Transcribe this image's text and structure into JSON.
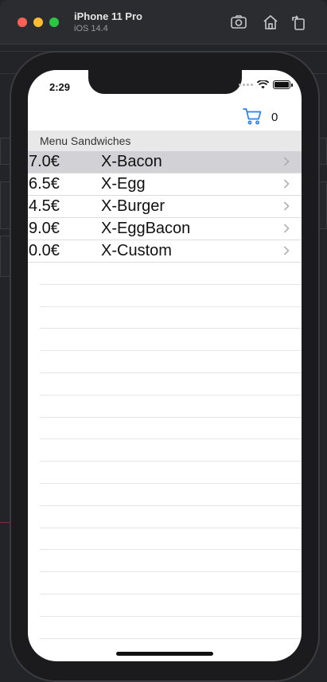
{
  "simulator": {
    "device_name": "iPhone 11 Pro",
    "os_version": "iOS 14.4",
    "icons": [
      "screenshot-icon",
      "home-icon",
      "rotate-icon"
    ]
  },
  "status_bar": {
    "time": "2:29"
  },
  "nav": {
    "cart_icon": "cart-icon",
    "cart_count": "0",
    "accent_color": "#2f80ed"
  },
  "menu": {
    "section_title": "Menu Sandwiches",
    "items": [
      {
        "price": "7.0€",
        "name": "X-Bacon",
        "selected": true
      },
      {
        "price": "6.5€",
        "name": "X-Egg",
        "selected": false
      },
      {
        "price": "4.5€",
        "name": "X-Burger",
        "selected": false
      },
      {
        "price": "9.0€",
        "name": "X-EggBacon",
        "selected": false
      },
      {
        "price": "0.0€",
        "name": "X-Custom",
        "selected": false
      }
    ]
  }
}
